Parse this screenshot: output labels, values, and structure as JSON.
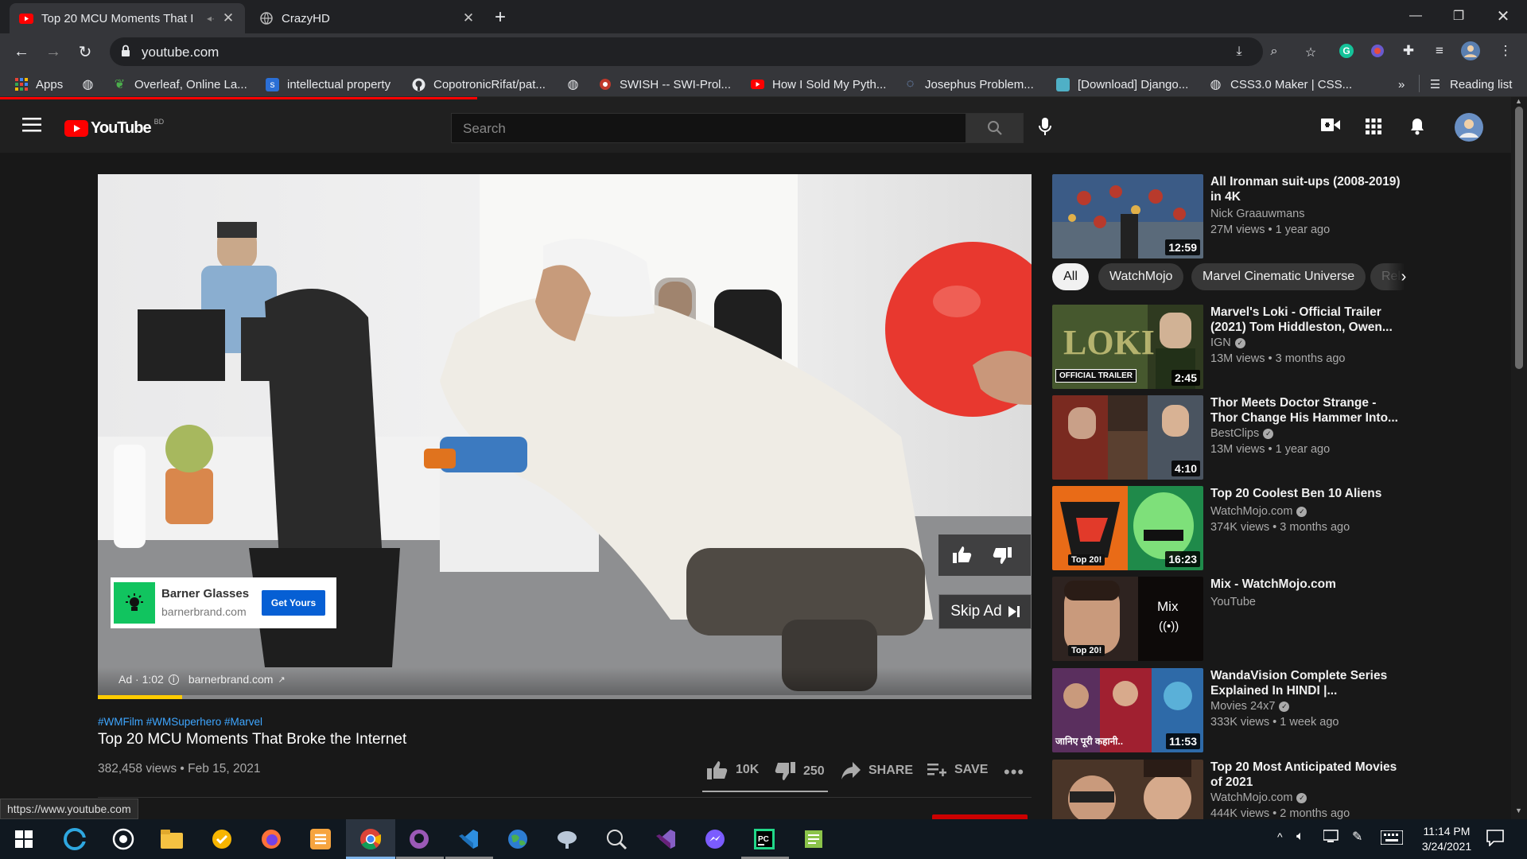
{
  "browser": {
    "tabs": [
      {
        "title": "Top 20 MCU Moments That I",
        "favicon": "youtube-icon",
        "active": true
      },
      {
        "title": "CrazyHD",
        "favicon": "globe-icon",
        "active": false
      }
    ],
    "url": "youtube.com",
    "bookmarks": [
      {
        "label": "Apps",
        "icon": "apps-grid-icon"
      },
      {
        "label": "",
        "icon": "globe-icon"
      },
      {
        "label": "Overleaf, Online La...",
        "icon": "overleaf-icon"
      },
      {
        "label": "intellectual property",
        "icon": "s-icon"
      },
      {
        "label": "CopotronicRifat/pat...",
        "icon": "github-icon"
      },
      {
        "label": "",
        "icon": "globe-icon"
      },
      {
        "label": "SWISH -- SWI-Prol...",
        "icon": "swish-icon"
      },
      {
        "label": "How I Sold My Pyth...",
        "icon": "youtube-icon"
      },
      {
        "label": "Josephus Problem...",
        "icon": "loading-icon"
      },
      {
        "label": "[Download] Django...",
        "icon": "image-icon"
      },
      {
        "label": "CSS3.0 Maker | CSS...",
        "icon": "globe-icon"
      }
    ],
    "more_label": "»",
    "reading_list": "Reading list",
    "status_url": "https://www.youtube.com"
  },
  "youtube": {
    "logo_text": "YouTube",
    "country": "BD",
    "search_placeholder": "Search",
    "ad": {
      "advertiser": "Barner Glasses",
      "domain": "barnerbrand.com",
      "cta": "Get Yours",
      "ad_time": "Ad · 1:02",
      "footer_domain": "barnerbrand.com",
      "skip_label": "Skip Ad",
      "progress": 0.09
    },
    "video": {
      "hashtags": "#WMFilm #WMSuperhero #Marvel",
      "title": "Top 20 MCU Moments That Broke the Internet",
      "views_date": "382,458 views • Feb 15, 2021",
      "likes": "10K",
      "dislikes": "250",
      "share_label": "SHARE",
      "save_label": "SAVE"
    },
    "chips": [
      "All",
      "WatchMojo",
      "Marvel Cinematic Universe",
      "Relat"
    ],
    "recommendations": [
      {
        "title": "All Ironman suit-ups (2008-2019) in 4K",
        "channel": "Nick Graauwmans",
        "meta": "27M views • 1 year ago",
        "duration": "12:59",
        "verified": false
      },
      {
        "title": "Marvel's Loki - Official Trailer (2021) Tom Hiddleston, Owen...",
        "channel": "IGN",
        "meta": "13M views • 3 months ago",
        "duration": "2:45",
        "verified": true,
        "badge": "OFFICIAL TRAILER"
      },
      {
        "title": "Thor Meets Doctor Strange - Thor Change His Hammer Into...",
        "channel": "BestClips",
        "meta": "13M views • 1 year ago",
        "duration": "4:10",
        "verified": true
      },
      {
        "title": "Top 20 Coolest Ben 10 Aliens",
        "channel": "WatchMojo.com",
        "meta": "374K views • 3 months ago",
        "duration": "16:23",
        "verified": true,
        "badge": "Top 20!"
      },
      {
        "title": "Mix - WatchMojo.com",
        "channel": "YouTube",
        "meta": "",
        "duration": "",
        "verified": false,
        "mix_label": "Mix",
        "badge": "Top 20!"
      },
      {
        "title": "WandaVision Complete Series Explained In HINDI |...",
        "channel": "Movies 24x7",
        "meta": "333K views • 1 week ago",
        "duration": "11:53",
        "verified": true,
        "badge": "जानिए पूरी कहानी.."
      },
      {
        "title": "Top 20 Most Anticipated Movies of 2021",
        "channel": "WatchMojo.com",
        "meta": "444K views • 2 months ago",
        "duration": "",
        "verified": true
      }
    ]
  },
  "taskbar": {
    "time": "11:14 PM",
    "date": "3/24/2021",
    "apps": [
      "windows-start-icon",
      "edge-icon",
      "whatsapp-icon",
      "file-explorer-icon",
      "norton-icon",
      "firefox-icon",
      "sublime-icon",
      "chrome-icon",
      "github-desktop-icon",
      "vscode-icon",
      "earth-icon",
      "app-icon",
      "app-icon-2",
      "visual-studio-icon",
      "messenger-icon",
      "pycharm-icon",
      "notepad-icon"
    ]
  },
  "colors": {
    "yt_red": "#ff0000",
    "cta_blue": "#065fd4",
    "ad_yellow": "#ffcc00"
  }
}
